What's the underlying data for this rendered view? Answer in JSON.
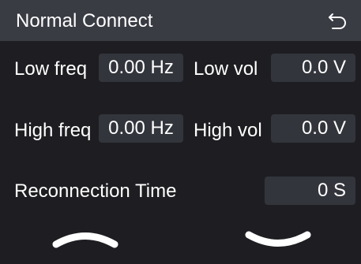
{
  "header": {
    "title": "Normal Connect",
    "back_icon": "back-return-icon"
  },
  "rows": {
    "low_freq_label": "Low freq",
    "low_freq_value": "0.00 Hz",
    "low_vol_label": "Low vol",
    "low_vol_value": "0.0 V",
    "high_freq_label": "High freq",
    "high_freq_value": "0.00 Hz",
    "high_vol_label": "High vol",
    "high_vol_value": "0.0 V",
    "reconnection_label": "Reconnection Time",
    "reconnection_value": "0 S"
  },
  "nav": {
    "up_icon": "chevron-up-icon",
    "down_icon": "chevron-down-icon"
  },
  "colors": {
    "background": "#1e1e22",
    "header": "#3a3c44",
    "field": "#33353c",
    "text": "#ffffff"
  }
}
